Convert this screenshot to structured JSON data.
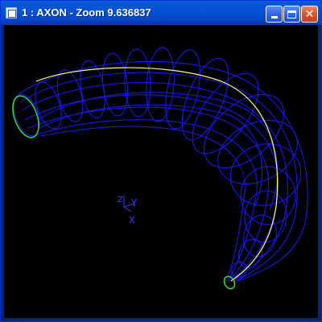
{
  "window": {
    "title": "1 : AXON - Zoom 9.636837",
    "buttons": {
      "minimize": "minimize",
      "maximize": "maximize",
      "close": "close"
    }
  },
  "viewport": {
    "background": "#000000",
    "wire_color": "#1a1aff",
    "spine_color": "#ffff66",
    "profile_color": "#33dd33",
    "axis_color": "#3a3aff",
    "axis_labels": {
      "y": "Y",
      "z": "Z",
      "x": "X"
    }
  }
}
